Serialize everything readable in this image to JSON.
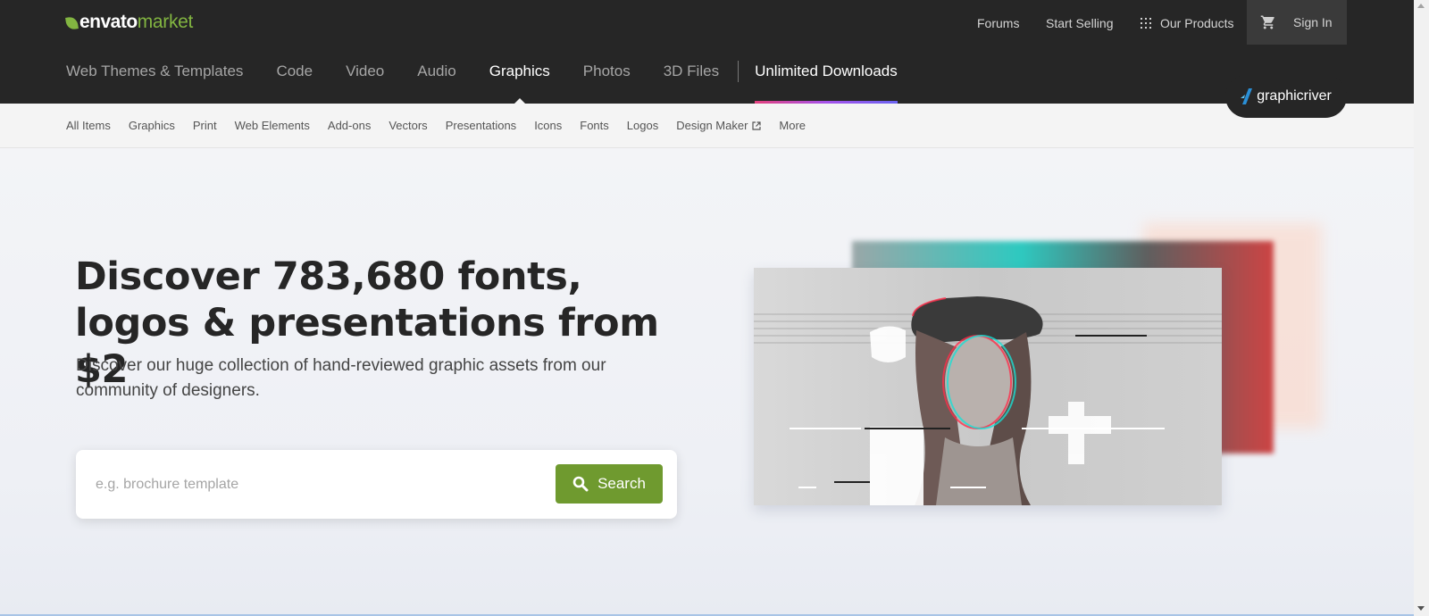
{
  "brand": {
    "name_bold": "envato",
    "name_light": "market",
    "accent": "#82b541"
  },
  "utility_nav": {
    "forums": "Forums",
    "start_selling": "Start Selling",
    "our_products": "Our Products",
    "sign_in": "Sign In"
  },
  "main_nav": {
    "items": [
      "Web Themes & Templates",
      "Code",
      "Video",
      "Audio",
      "Graphics",
      "Photos",
      "3D Files"
    ],
    "active": "Graphics",
    "unlimited": "Unlimited Downloads"
  },
  "site_badge": "graphicriver",
  "sub_nav": [
    "All Items",
    "Graphics",
    "Print",
    "Web Elements",
    "Add-ons",
    "Vectors",
    "Presentations",
    "Icons",
    "Fonts",
    "Logos",
    "Design Maker",
    "More"
  ],
  "hero": {
    "title": "Discover 783,680 fonts, logos & presentations from $2",
    "subtitle": "Discover our huge collection of hand-reviewed graphic assets from our community of designers.",
    "search_placeholder": "e.g. brochure template",
    "search_button": "Search",
    "button_color": "#6f9a2f"
  }
}
